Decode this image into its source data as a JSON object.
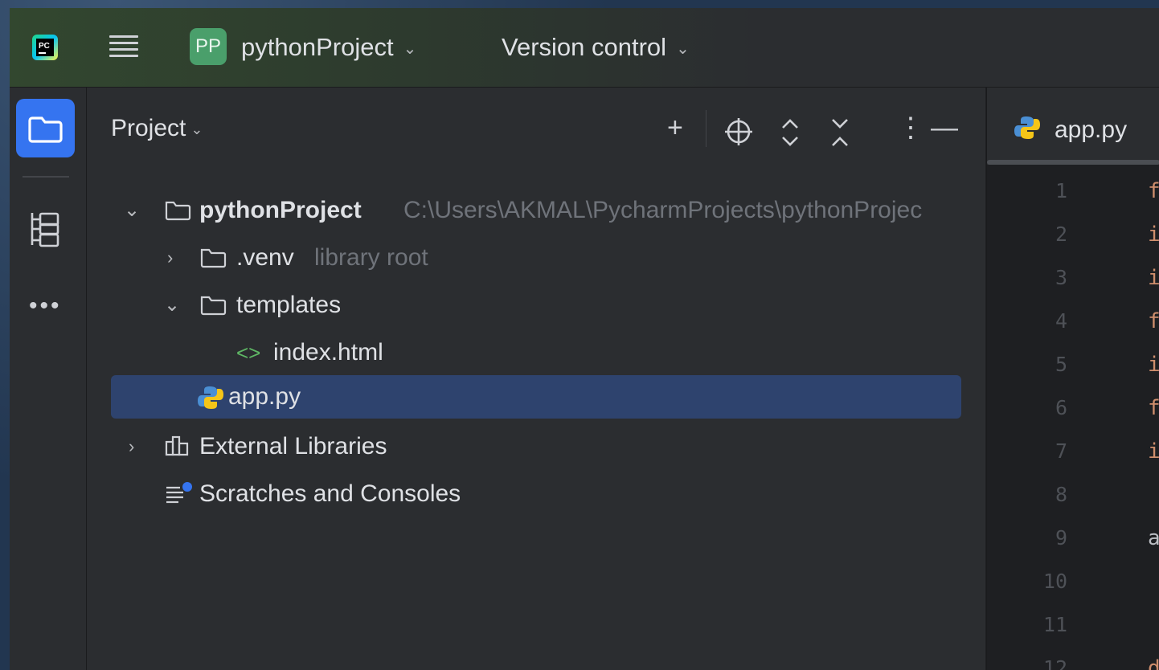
{
  "titlebar": {
    "project_badge": "PP",
    "project_name": "pythonProject",
    "version_control": "Version control"
  },
  "project_panel": {
    "title": "Project",
    "tree": [
      {
        "label": "pythonProject",
        "hint": "C:\\Users\\AKMAL\\PycharmProjects\\pythonProjec",
        "expanded": true
      },
      {
        "label": ".venv",
        "hint": "library root",
        "expanded": false
      },
      {
        "label": "templates",
        "expanded": true
      },
      {
        "label": "index.html"
      },
      {
        "label": "app.py",
        "selected": true
      },
      {
        "label": "External Libraries",
        "expanded": false
      },
      {
        "label": "Scratches and Consoles"
      }
    ]
  },
  "editor": {
    "tab": "app.py",
    "line_numbers": [
      "1",
      "2",
      "3",
      "4",
      "5",
      "6",
      "7",
      "8",
      "9",
      "10",
      "11",
      "12"
    ],
    "code_lines": [
      "fr",
      "in",
      "in",
      "fr",
      "in",
      "fr",
      "in",
      "",
      "ap",
      "",
      "",
      "de"
    ]
  },
  "colors": {
    "accent": "#3574f0",
    "selection": "#2e436e",
    "keyword": "#cf8e6d",
    "project_badge": "#4a9f6b"
  }
}
